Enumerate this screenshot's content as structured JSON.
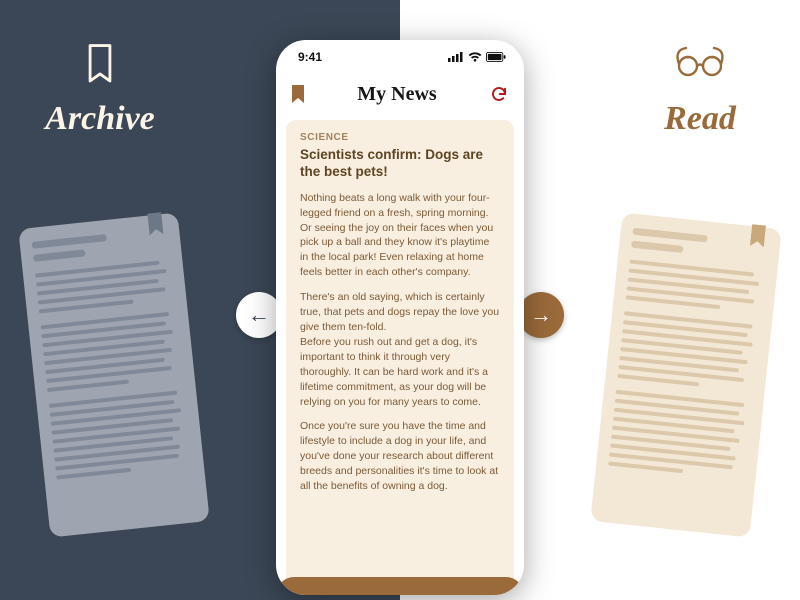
{
  "panels": {
    "left": {
      "label": "Archive",
      "icon": "bookmark-icon"
    },
    "right": {
      "label": "Read",
      "icon": "glasses-icon"
    }
  },
  "swipe": {
    "left_glyph": "←",
    "right_glyph": "→"
  },
  "phone": {
    "status_time": "9:41",
    "app_title": "My News"
  },
  "article": {
    "kicker": "SCIENCE",
    "headline": "Scientists confirm: Dogs are the best pets!",
    "paragraphs": [
      "Nothing beats a long walk with your four-legged friend on a fresh, spring morning. Or seeing the joy on their faces when you pick up a ball and they know it's playtime in the local park! Even relaxing at home feels better in each other's company.",
      "There's an old saying, which is certainly true, that pets and dogs repay the love you give them ten-fold.\nBefore you rush out and get a dog, it's important to think it through very thoroughly. It can be hard work and it's a lifetime commitment, as your dog will be relying on you for many years to come.",
      "Once you're sure you have the time and lifestyle to include a dog in your life, and you've done your research about different breeds and personalities it's time to look at all the benefits of owning a dog."
    ]
  },
  "colors": {
    "dark_bg": "#3b4756",
    "cream": "#f9efe1",
    "brown": "#9a6a3a"
  }
}
